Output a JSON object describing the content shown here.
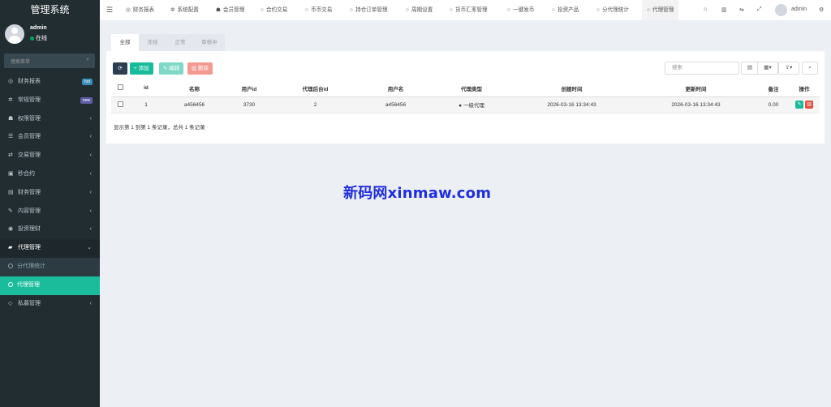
{
  "brand": "管理系统",
  "user": {
    "name": "admin",
    "status": "在线"
  },
  "sidebar": {
    "search_placeholder": "搜索菜单",
    "items": [
      {
        "label": "财务报表",
        "badge": "hot",
        "badge_color": "#3c8dbc",
        "icon": "dashboard-icon",
        "glyph": "◎"
      },
      {
        "label": "常规管理",
        "badge": "new",
        "badge_color": "#605ca8",
        "icon": "cogs-icon",
        "glyph": "✲"
      },
      {
        "label": "权限管理",
        "icon": "group-icon",
        "glyph": "☗"
      },
      {
        "label": "会员管理",
        "icon": "list-icon",
        "glyph": "☰"
      },
      {
        "label": "交易管理",
        "icon": "handshake-icon",
        "glyph": "⇄"
      },
      {
        "label": "秒合约",
        "icon": "calendar-icon",
        "glyph": "▣"
      },
      {
        "label": "财务管理",
        "icon": "book-icon",
        "glyph": "▤"
      },
      {
        "label": "内容管理",
        "icon": "edit-icon",
        "glyph": "✎"
      },
      {
        "label": "投资理财",
        "icon": "money-icon",
        "glyph": "◉"
      },
      {
        "label": "代理管理",
        "icon": "briefcase-icon",
        "glyph": "▰"
      },
      {
        "label": "分代理统计",
        "icon": "circle-icon"
      },
      {
        "label": "代理管理",
        "icon": "circle-icon"
      },
      {
        "label": "私募管理",
        "icon": "diamond-icon",
        "glyph": "◇"
      }
    ]
  },
  "topnav": {
    "tabs": [
      {
        "label": "财务报表",
        "glyph": "◎"
      },
      {
        "label": "系统配置",
        "glyph": "✲"
      },
      {
        "label": "会员管理",
        "glyph": "☗"
      },
      {
        "label": "合约交易",
        "glyph": "○"
      },
      {
        "label": "币币交易",
        "glyph": "○"
      },
      {
        "label": "持仓订单管理",
        "glyph": "○"
      },
      {
        "label": "周期设置",
        "glyph": "○"
      },
      {
        "label": "货币汇率管理",
        "glyph": "○"
      },
      {
        "label": "一键发币",
        "glyph": "○"
      },
      {
        "label": "投资产品",
        "glyph": "○"
      },
      {
        "label": "分代理统计",
        "glyph": "○"
      },
      {
        "label": "代理管理",
        "glyph": "○"
      }
    ],
    "user": "admin"
  },
  "content": {
    "status_tabs": [
      "全部",
      "冻结",
      "正常",
      "审核中"
    ],
    "toolbar": {
      "add": "添加",
      "edit": "编辑",
      "delete": "删除"
    },
    "search_placeholder": "搜索",
    "columns": [
      "id",
      "名称",
      "用户id",
      "代理后台id",
      "用户名",
      "代理类型",
      "创建时间",
      "更新时间",
      "备注",
      "操作"
    ],
    "rows": [
      {
        "id": "1",
        "name": "a456456",
        "user_id": "3730",
        "agent_admin_id": "2",
        "username": "a456456",
        "agent_type": "一级代理",
        "created": "2026-03-16 13:34:43",
        "updated": "2026-03-16 13:34:43",
        "remark": "0.00"
      }
    ],
    "summary": "显示第 1 到第 1 条记录，总共 1 条记录"
  },
  "watermark": "新码网xinmaw.com",
  "colors": {
    "sidebar_bg": "#222d32",
    "active_item": "#1abc9c",
    "add_btn": "#18bc9c",
    "delete_btn": "#e74c3c",
    "edit_btn": "#2c3e50"
  }
}
